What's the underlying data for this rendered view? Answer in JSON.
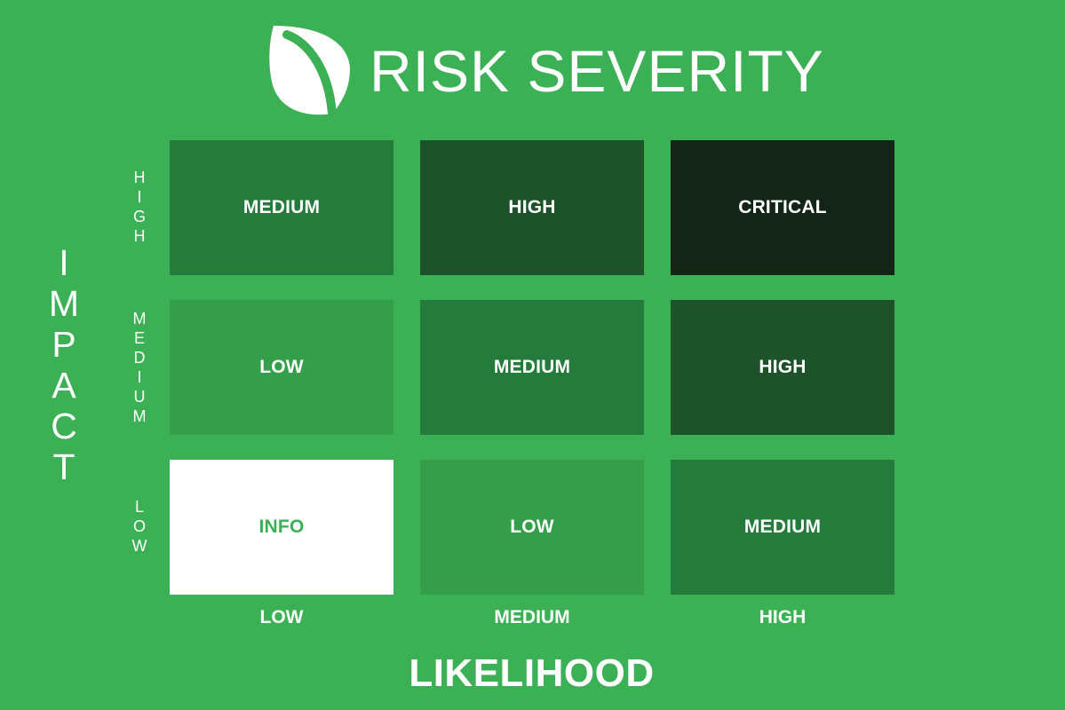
{
  "title": "RISK SEVERITY",
  "logo": "leaf-icon",
  "axes": {
    "y_label": "IMPACT",
    "x_label": "LIKELIHOOD",
    "rows": [
      "HIGH",
      "MEDIUM",
      "LOW"
    ],
    "columns": [
      "LOW",
      "MEDIUM",
      "HIGH"
    ]
  },
  "matrix": [
    [
      "MEDIUM",
      "HIGH",
      "CRITICAL"
    ],
    [
      "LOW",
      "MEDIUM",
      "HIGH"
    ],
    [
      "INFO",
      "LOW",
      "MEDIUM"
    ]
  ],
  "colors": {
    "background": "#3cb055",
    "INFO": "#ffffff",
    "LOW": "#349e4b",
    "MEDIUM": "#247b3c",
    "HIGH": "#1e522a",
    "CRITICAL": "#132516",
    "info_text": "#3cb055",
    "text": "#ffffff"
  }
}
